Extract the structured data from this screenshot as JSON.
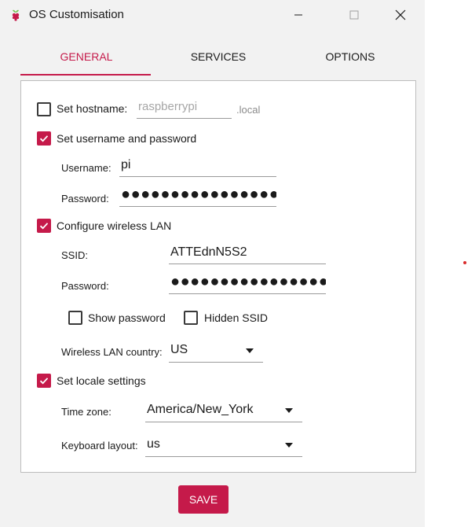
{
  "window": {
    "title": "OS Customisation",
    "accent_color": "#c51a4a"
  },
  "tabs": [
    {
      "label": "GENERAL",
      "active": true
    },
    {
      "label": "SERVICES",
      "active": false
    },
    {
      "label": "OPTIONS",
      "active": false
    }
  ],
  "hostname": {
    "label": "Set hostname:",
    "checked": false,
    "placeholder": "raspberrypi",
    "suffix": ".local"
  },
  "user": {
    "label": "Set username and password",
    "checked": true,
    "username_label": "Username:",
    "username_value": "pi",
    "password_label": "Password:",
    "password_value": "●●●●●●●●●●●●●●●●●●●●"
  },
  "wifi": {
    "label": "Configure wireless LAN",
    "checked": true,
    "ssid_label": "SSID:",
    "ssid_value": "ATTEdnN5S2",
    "password_label": "Password:",
    "password_value": "●●●●●●●●●●●●●●●●●●●●●●",
    "show_password_label": "Show password",
    "show_password_checked": false,
    "hidden_ssid_label": "Hidden SSID",
    "hidden_ssid_checked": false,
    "country_label": "Wireless LAN country:",
    "country_value": "US"
  },
  "locale": {
    "label": "Set locale settings",
    "checked": true,
    "timezone_label": "Time zone:",
    "timezone_value": "America/New_York",
    "keyboard_label": "Keyboard layout:",
    "keyboard_value": "us"
  },
  "footer": {
    "save_label": "SAVE"
  }
}
